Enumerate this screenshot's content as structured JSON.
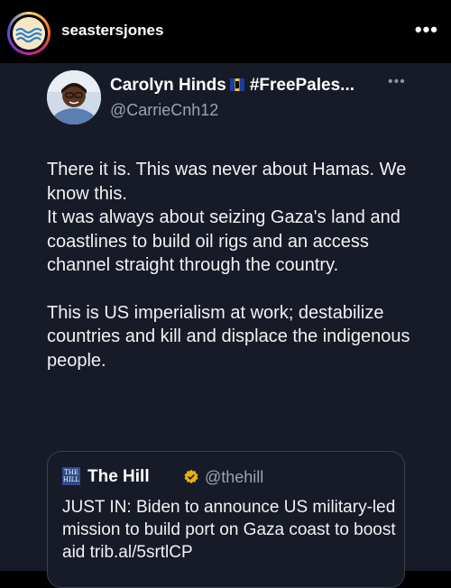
{
  "header": {
    "username": "seastersjones",
    "more_label": "•••"
  },
  "post": {
    "author_name": "Carolyn Hinds",
    "author_tag": "#FreePales...",
    "author_handle": "@CarrieCnh12",
    "more_label": "•••",
    "paragraphs": [
      "There it is. This was never about Hamas. We know this.",
      "It was always about seizing Gaza's land and coastlines to build oil rigs and an access channel straight through the country.",
      "This is US imperialism at work; destabilize countries and kill and displace the indigenous people."
    ],
    "quote": {
      "logo_text": "THE HILL",
      "name": "The Hill",
      "handle": "@thehill",
      "text": "JUST IN: Biden to announce US military-led mission to build port on Gaza coast to boost aid trib.al/5srtlCP"
    }
  },
  "colors": {
    "background": "#000000",
    "card": "#171b27",
    "muted": "#9aa3b2",
    "verified": "#e8b10a"
  }
}
